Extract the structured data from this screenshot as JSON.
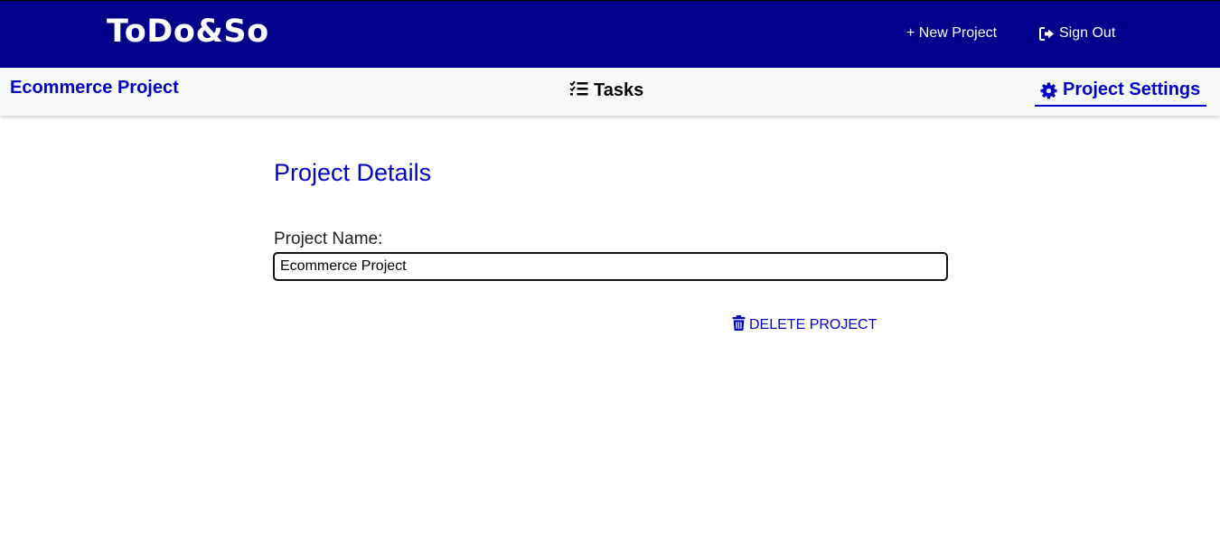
{
  "header": {
    "logo": "ToDo&So",
    "new_project_label": "+ New Project",
    "sign_out_label": "Sign Out",
    "background_color": "#00008b"
  },
  "subnav": {
    "project_name": "Ecommerce Project",
    "tasks_label": "Tasks",
    "tasks_icon": "list-check-icon",
    "settings_label": "Project Settings",
    "settings_icon": "gear-icon",
    "active_tab": "Project Settings",
    "accent_color": "#0000cd"
  },
  "main": {
    "section_title": "Project Details",
    "project_name_label": "Project Name:",
    "project_name_value": "Ecommerce Project",
    "delete_label": "DELETE PROJECT",
    "delete_icon": "trash-icon"
  }
}
